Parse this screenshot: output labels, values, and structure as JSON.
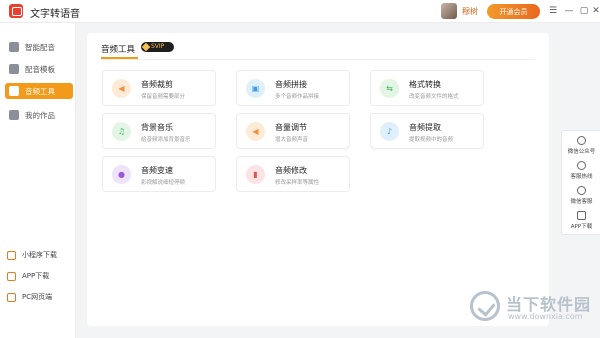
{
  "titlebar": {
    "app_title": "文字转语音",
    "username": "穆树",
    "vip_button": "开通会员",
    "menu_icon": "menu-icon",
    "min_icon": "minimize-icon",
    "max_icon": "maximize-icon",
    "close_icon": "close-icon"
  },
  "sidebar": {
    "items": [
      {
        "label": "智能配音",
        "icon": "mic-icon"
      },
      {
        "label": "配音模板",
        "icon": "template-icon"
      },
      {
        "label": "音频工具",
        "icon": "folder-icon",
        "active": true
      },
      {
        "label": "我的作品",
        "icon": "works-icon"
      }
    ],
    "bottom": [
      {
        "label": "小程序下载",
        "icon": "miniapp-icon"
      },
      {
        "label": "APP下载",
        "icon": "phone-icon"
      },
      {
        "label": "PC网页端",
        "icon": "monitor-icon"
      }
    ]
  },
  "main": {
    "tab_title": "音频工具",
    "badge": "SVIP",
    "tools": [
      {
        "title": "音频裁剪",
        "desc": "保留音频需要部分",
        "icon": "scissors-icon",
        "bg": "#fdebd7",
        "fg": "#f0903a"
      },
      {
        "title": "音频拼接",
        "desc": "多个音频作品拼接",
        "icon": "merge-icon",
        "bg": "#dff0fb",
        "fg": "#3b9fe4"
      },
      {
        "title": "格式转换",
        "desc": "改变音频文件的格式",
        "icon": "convert-icon",
        "bg": "#e3f5e5",
        "fg": "#3fb35a"
      },
      {
        "title": "背景音乐",
        "desc": "给音频添加背景音乐",
        "icon": "music-icon",
        "bg": "#e3f5e5",
        "fg": "#3fb35a"
      },
      {
        "title": "音量调节",
        "desc": "增大音频声音",
        "icon": "volume-icon",
        "bg": "#fdebd7",
        "fg": "#f0903a"
      },
      {
        "title": "音频提取",
        "desc": "提取视频中的音频",
        "icon": "extract-icon",
        "bg": "#dff0fb",
        "fg": "#3b9fe4"
      },
      {
        "title": "音频变速",
        "desc": "影视解说细短停顿",
        "icon": "speed-icon",
        "bg": "#efe3fa",
        "fg": "#9b59d6"
      },
      {
        "title": "音频修改",
        "desc": "修改采样率等属性",
        "icon": "bars-icon",
        "bg": "#fde3e3",
        "fg": "#e8504f"
      }
    ]
  },
  "rightbar": {
    "items": [
      {
        "label": "微信公众号",
        "icon": "wechat-icon"
      },
      {
        "label": "客服热线",
        "icon": "phone-call-icon"
      },
      {
        "label": "微信客服",
        "icon": "chat-icon"
      },
      {
        "label": "APP下载",
        "icon": "app-icon"
      }
    ]
  },
  "watermark": {
    "text": "当下软件园",
    "url": "www.downxia.com"
  }
}
